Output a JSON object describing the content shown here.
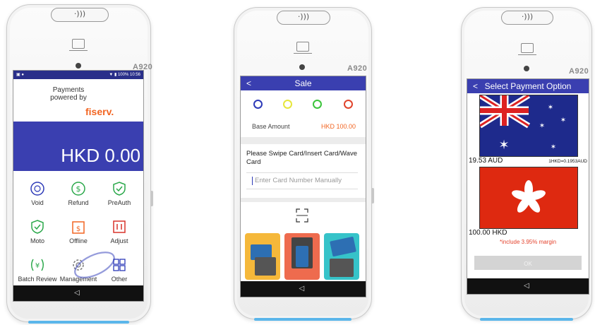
{
  "devices": [
    {
      "nfc_label": "·)))",
      "brand": "A920",
      "statusbar": {
        "left": "▣ ●",
        "right": "▼ ▮ 100% 10:56"
      },
      "payments_line1": "Payments",
      "payments_line2": "powered by",
      "logo": "fiserv.",
      "amount": "HKD 0.00",
      "menu": [
        {
          "label": "Void",
          "icon": "void-icon"
        },
        {
          "label": "Refund",
          "icon": "refund-icon"
        },
        {
          "label": "PreAuth",
          "icon": "preauth-icon"
        },
        {
          "label": "Moto",
          "icon": "moto-icon"
        },
        {
          "label": "Offline",
          "icon": "offline-icon"
        },
        {
          "label": "Adjust",
          "icon": "adjust-icon"
        },
        {
          "label": "Batch Review",
          "icon": "batch-review-icon"
        },
        {
          "label": "Management",
          "icon": "management-icon"
        },
        {
          "label": "Other",
          "icon": "other-icon"
        }
      ],
      "nav_back": "◁"
    },
    {
      "nfc_label": "·)))",
      "brand": "A920",
      "header_title": "Sale",
      "back": "<",
      "ring_colors": [
        "#2d3ab8",
        "#e6e63c",
        "#3cc43c",
        "#e0442c"
      ],
      "base_amount_label": "Base Amount",
      "base_amount_value": "HKD 100.00",
      "prompt": "Please Swipe Card/Insert Card/Wave Card",
      "card_placeholder": "Enter Card Number Manually",
      "scan_icon": "scan-icon",
      "tiles": [
        {
          "name": "swipe",
          "color": "#f5b83a"
        },
        {
          "name": "insert",
          "color": "#ee6b4e"
        },
        {
          "name": "wave",
          "color": "#36c3c9"
        }
      ],
      "nav_back": "◁"
    },
    {
      "nfc_label": "·)))",
      "brand": "A920",
      "header_title": "Select Payment Option",
      "back": "<",
      "option1_amount": "19.53 AUD",
      "option1_rate": "1HKD=0.1953AUD",
      "option2_amount": "100.00 HKD",
      "margin_note": "*include 3.95% margin",
      "ok_label": "OK",
      "nav_back": "◁"
    }
  ]
}
